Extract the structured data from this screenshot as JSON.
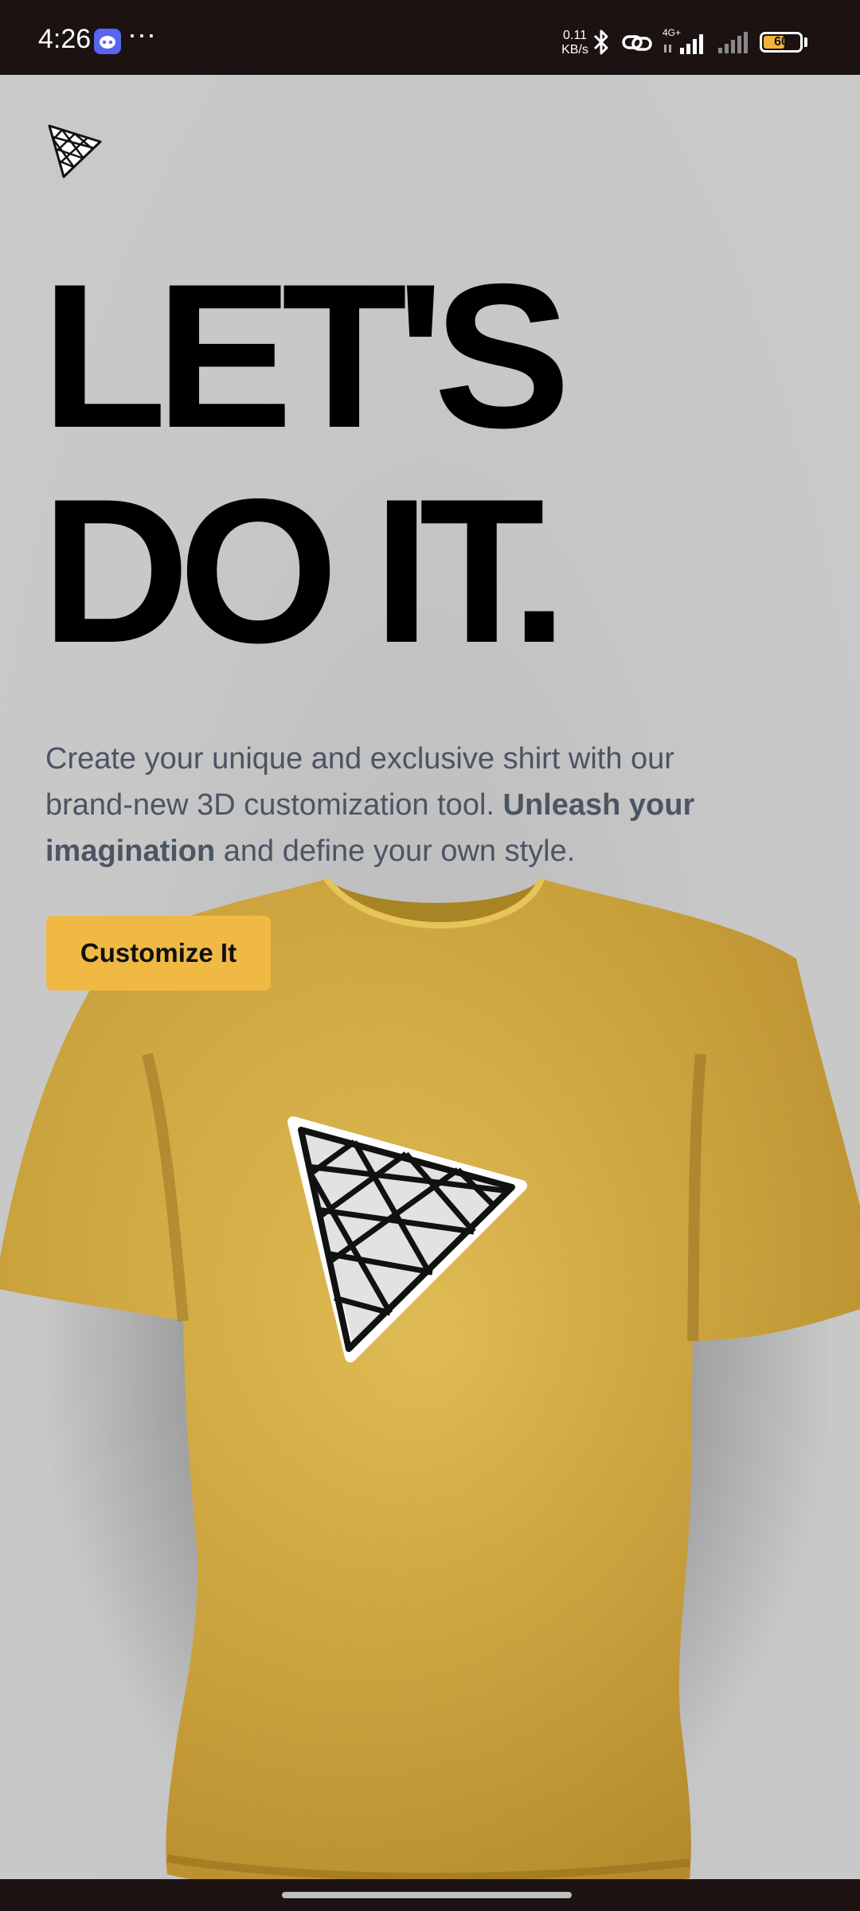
{
  "status_bar": {
    "time": "4:26",
    "net_speed_value": "0.11",
    "net_speed_unit": "KB/s",
    "network_type": "4G+",
    "battery_level": "60",
    "battery_fraction": 0.6,
    "icons": [
      "discord-icon",
      "more-dots-icon",
      "bluetooth-icon",
      "link-icon",
      "signal-icon",
      "signal-icon"
    ]
  },
  "brand": {
    "logo_icon": "triangle-mesh-logo-icon"
  },
  "hero": {
    "headline_line1": "LET'S",
    "headline_line2": "DO IT.",
    "intro_part1": "Create your unique and exclusive shirt with our brand-new 3D customization tool. ",
    "intro_bold": "Unleash your imagination",
    "intro_part2": " and define your own style.",
    "cta_label": "Customize It"
  },
  "colors": {
    "background": "#c9c9ca",
    "accent": "#efb944",
    "shirt": "#d9b043",
    "text_muted": "#4b5563",
    "status_bar": "#1c1212"
  }
}
